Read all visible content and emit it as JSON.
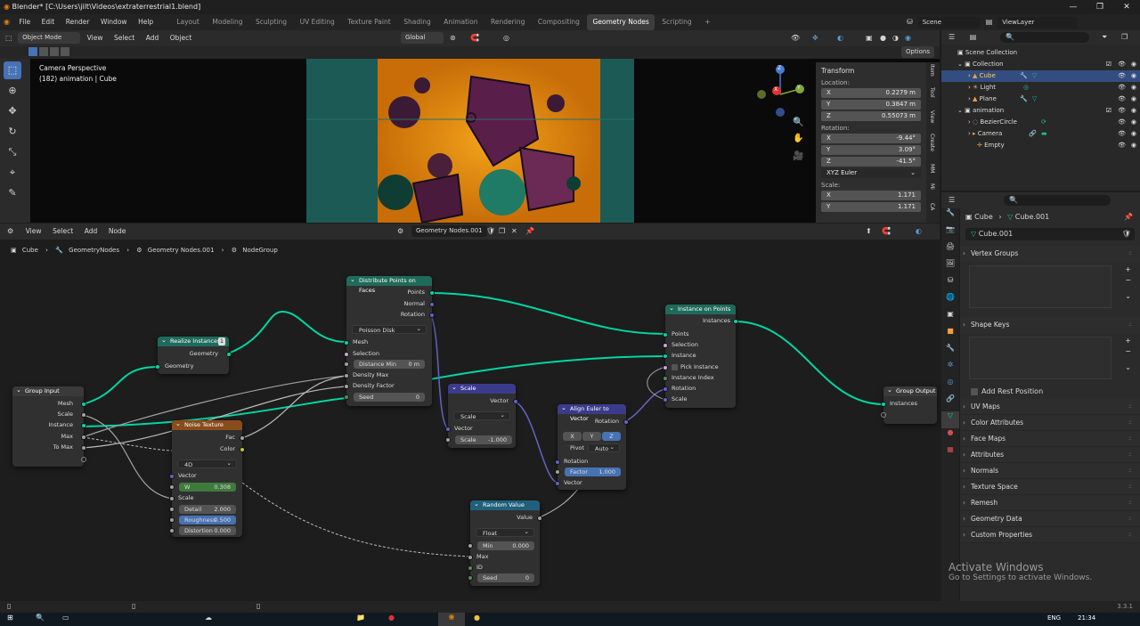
{
  "window": {
    "title": "Blender* [C:\\Users\\jilt\\Videos\\extraterrestrial1.blend]",
    "minimize": "—",
    "maximize": "❐",
    "close": "✕"
  },
  "menu": [
    "File",
    "Edit",
    "Render",
    "Window",
    "Help"
  ],
  "workspaces": [
    "Layout",
    "Modeling",
    "Sculpting",
    "UV Editing",
    "Texture Paint",
    "Shading",
    "Animation",
    "Rendering",
    "Compositing",
    "Geometry Nodes",
    "Scripting",
    "+"
  ],
  "active_workspace": "Geometry Nodes",
  "scene": {
    "label": "Scene",
    "view_layer": "ViewLayer"
  },
  "viewport": {
    "mode": "Object Mode",
    "menus": [
      "View",
      "Select",
      "Add",
      "Object"
    ],
    "transform_orientation": "Global",
    "options": "Options",
    "overlay_title": "Camera Perspective",
    "overlay_subtitle": "(182) animation | Cube",
    "gizmo": {
      "z": "Z",
      "y": "Y",
      "x": "X"
    }
  },
  "npanel": {
    "title": "Transform",
    "location_label": "Location:",
    "location": [
      {
        "k": "X",
        "v": "0.2279 m"
      },
      {
        "k": "Y",
        "v": "0.3847 m"
      },
      {
        "k": "Z",
        "v": "0.55073 m"
      }
    ],
    "rotation_label": "Rotation:",
    "rotation": [
      {
        "k": "X",
        "v": "-9.44°"
      },
      {
        "k": "Y",
        "v": "3.09°"
      },
      {
        "k": "Z",
        "v": "-41.5°"
      }
    ],
    "rotation_mode": "XYZ Euler",
    "scale_label": "Scale:",
    "scale": [
      {
        "k": "X",
        "v": "1.171"
      },
      {
        "k": "Y",
        "v": "1.171"
      }
    ],
    "tabs": [
      "Item",
      "Tool",
      "View",
      "Create",
      "MM",
      "Mi",
      "CA"
    ]
  },
  "node_editor": {
    "menus": [
      "View",
      "Select",
      "Add",
      "Node"
    ],
    "tree_name": "Geometry Nodes.001",
    "breadcrumb": [
      "Cube",
      "GeometryNodes",
      "Geometry Nodes.001",
      "NodeGroup"
    ]
  },
  "nodes": {
    "group_input": {
      "title": "Group Input",
      "outputs": [
        "Mesh",
        "Scale",
        "Instance",
        "Max",
        "To Max"
      ]
    },
    "realize": {
      "title": "Realize Instances",
      "badge": "1",
      "output": "Geometry",
      "input": "Geometry"
    },
    "distribute": {
      "title": "Distribute Points on Faces",
      "outputs": [
        "Points",
        "Normal",
        "Rotation"
      ],
      "mode": "Poisson Disk",
      "inputs": [
        "Mesh",
        "Selection"
      ],
      "distance_min": {
        "k": "Distance Min",
        "v": "0 m"
      },
      "more_inputs": [
        "Density Max",
        "Density Factor"
      ],
      "seed": {
        "k": "Seed",
        "v": "0"
      }
    },
    "noise": {
      "title": "Noise Texture",
      "outputs": [
        "Fac",
        "Color"
      ],
      "dim": "4D",
      "inputs": [
        "Vector"
      ],
      "w": {
        "k": "W",
        "v": "0.308"
      },
      "scale": "Scale",
      "detail": {
        "k": "Detail",
        "v": "2.000"
      },
      "roughness": {
        "k": "Roughness",
        "v": "0.500"
      },
      "distortion": {
        "k": "Distortion",
        "v": "0.000"
      }
    },
    "scale": {
      "title": "Scale",
      "output": "Vector",
      "mode": "Scale",
      "input": "Vector",
      "scale": {
        "k": "Scale",
        "v": "-1.000"
      }
    },
    "align": {
      "title": "Align Euler to Vector",
      "output": "Rotation",
      "axes": [
        "X",
        "Y",
        "Z"
      ],
      "pivot_label": "Pivot",
      "pivot": "Auto",
      "inputs": [
        "Rotation"
      ],
      "factor": {
        "k": "Factor",
        "v": "1.000"
      },
      "vector": "Vector"
    },
    "random": {
      "title": "Random Value",
      "output": "Value",
      "type": "Float",
      "min": {
        "k": "Min",
        "v": "0.000"
      },
      "inputs": [
        "Max",
        "ID"
      ],
      "seed": {
        "k": "Seed",
        "v": "0"
      }
    },
    "instance": {
      "title": "Instance on Points",
      "output": "Instances",
      "inputs": [
        "Points",
        "Selection",
        "Instance"
      ],
      "pick": "Pick Instance",
      "more_inputs": [
        "Instance Index",
        "Rotation",
        "Scale"
      ]
    },
    "group_output": {
      "title": "Group Output",
      "inputs": [
        "Instances"
      ]
    }
  },
  "outliner": {
    "rows": [
      {
        "label": "Scene Collection",
        "indent": 0
      },
      {
        "label": "Collection",
        "indent": 1
      },
      {
        "label": "Cube",
        "indent": 2
      },
      {
        "label": "Light",
        "indent": 2
      },
      {
        "label": "Plane",
        "indent": 2
      },
      {
        "label": "animation",
        "indent": 1
      },
      {
        "label": "BezierCircle",
        "indent": 2
      },
      {
        "label": "Camera",
        "indent": 2
      },
      {
        "label": "Empty",
        "indent": 2
      }
    ]
  },
  "properties": {
    "breadcrumb_object": "Cube",
    "breadcrumb_data": "Cube.001",
    "mesh_name": "Cube.001",
    "vertex_groups": "Vertex Groups",
    "shape_keys": "Shape Keys",
    "add_rest_position": "Add Rest Position",
    "sections": [
      "UV Maps",
      "Color Attributes",
      "Face Maps",
      "Attributes",
      "Normals",
      "Texture Space",
      "Remesh",
      "Geometry Data",
      "Custom Properties"
    ]
  },
  "watermark": {
    "line1": "Activate Windows",
    "line2": "Go to Settings to activate Windows."
  },
  "status": {
    "version": "3.3.1"
  },
  "taskbar": {
    "lang": "ENG",
    "time": "21:34"
  }
}
